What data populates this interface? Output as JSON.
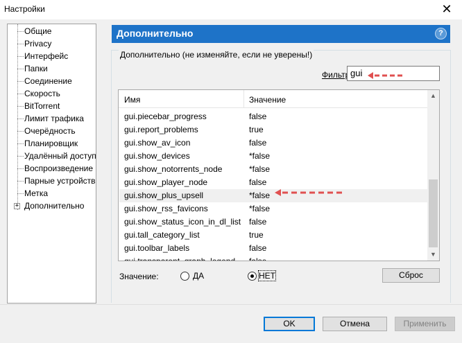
{
  "window": {
    "title": "Настройки",
    "close_glyph": "✕"
  },
  "tree": {
    "items": [
      {
        "label": "Общие"
      },
      {
        "label": "Privacy"
      },
      {
        "label": "Интерфейс"
      },
      {
        "label": "Папки"
      },
      {
        "label": "Соединение"
      },
      {
        "label": "Скорость"
      },
      {
        "label": "BitTorrent"
      },
      {
        "label": "Лимит трафика"
      },
      {
        "label": "Очерёдность"
      },
      {
        "label": "Планировщик"
      },
      {
        "label": "Удалённый доступ"
      },
      {
        "label": "Воспроизведение"
      },
      {
        "label": "Парные устройства"
      },
      {
        "label": "Метка"
      },
      {
        "label": "Дополнительно"
      }
    ],
    "expander_glyph": "+"
  },
  "header": {
    "title": "Дополнительно",
    "help_glyph": "?"
  },
  "group": {
    "label": "Дополнительно (не изменяйте, если не уверены!)"
  },
  "filter": {
    "label": "Фильтр",
    "value": "gui"
  },
  "list": {
    "col_name": "Имя",
    "col_value": "Значение",
    "rows": [
      {
        "name": "gui.piecebar_progress",
        "value": "false"
      },
      {
        "name": "gui.report_problems",
        "value": "true"
      },
      {
        "name": "gui.show_av_icon",
        "value": "false"
      },
      {
        "name": "gui.show_devices",
        "value": "*false"
      },
      {
        "name": "gui.show_notorrents_node",
        "value": "*false"
      },
      {
        "name": "gui.show_player_node",
        "value": "false"
      },
      {
        "name": "gui.show_plus_upsell",
        "value": "*false"
      },
      {
        "name": "gui.show_rss_favicons",
        "value": "*false"
      },
      {
        "name": "gui.show_status_icon_in_dl_list",
        "value": "false"
      },
      {
        "name": "gui.tall_category_list",
        "value": "true"
      },
      {
        "name": "gui.toolbar_labels",
        "value": "false"
      },
      {
        "name": "gui.transparent_graph_legend",
        "value": "false"
      }
    ],
    "scroll_up_glyph": "▲",
    "scroll_down_glyph": "▼"
  },
  "value_editor": {
    "label": "Значение:",
    "option_yes": "ДА",
    "option_no": "НЕТ",
    "selected": "НЕТ",
    "reset": "Сброс"
  },
  "footer": {
    "ok": "OK",
    "cancel": "Отмена",
    "apply": "Применить"
  },
  "colors": {
    "header_bg": "#1e73c8",
    "annotation_arrow": "#e05050"
  }
}
